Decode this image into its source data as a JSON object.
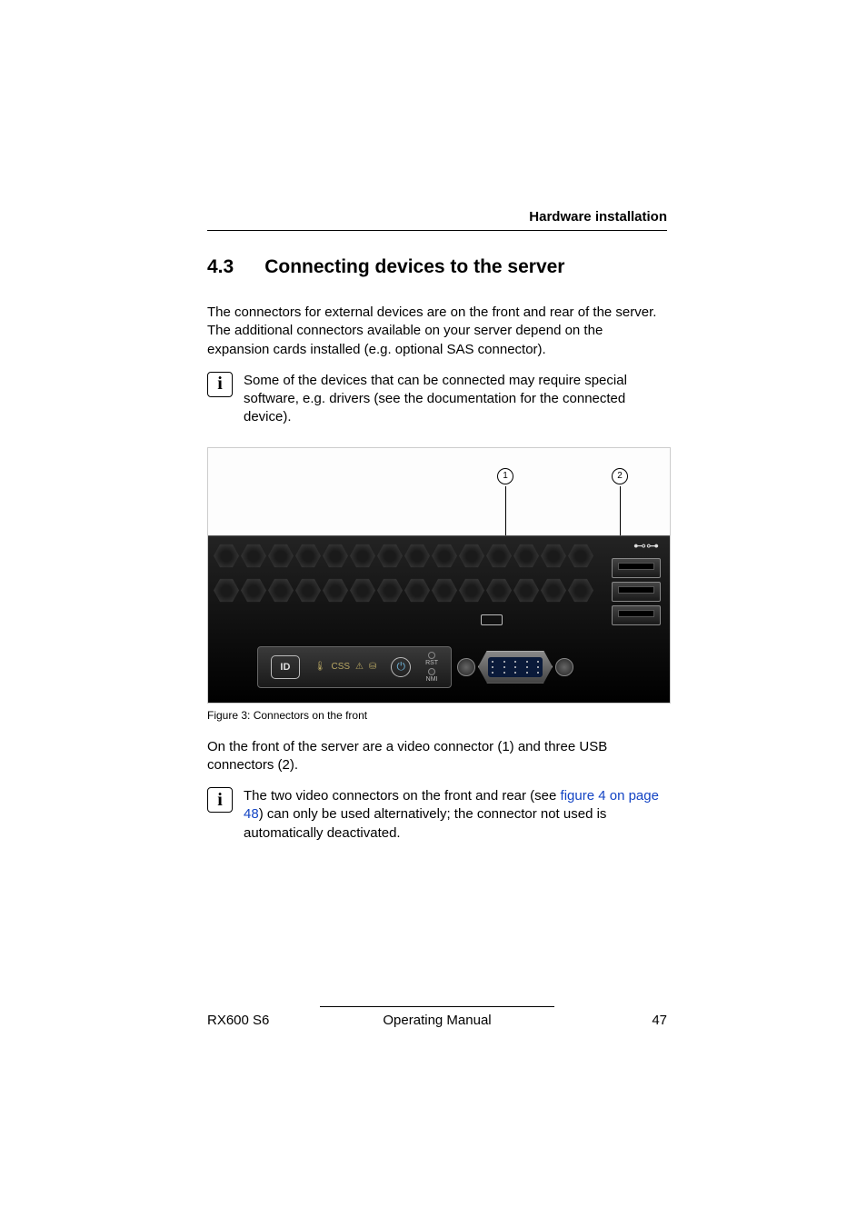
{
  "header": {
    "running_title": "Hardware installation"
  },
  "section": {
    "number": "4.3",
    "title": "Connecting devices to the server"
  },
  "paragraphs": {
    "intro": "The connectors for external devices are on the front and rear of the server. The additional connectors available on your server depend on the expansion cards installed (e.g. optional SAS connector).",
    "front_desc": "On the front of the server are a video connector (1) and three USB connectors (2)."
  },
  "notes": {
    "note1": "Some of the devices that can be connected may require special software, e.g. drivers (see the documentation for the connected device).",
    "note2_before_link": "The two video connectors on the front and rear (see ",
    "note2_link": "figure 4 on page 48",
    "note2_after_link": ") can only be used alternatively; the connector not used is automatically deactivated."
  },
  "figure": {
    "callout1": "1",
    "callout2": "2",
    "id_label": "ID",
    "rst_label": "RST",
    "nmi_label": "NMI",
    "caption": "Figure 3: Connectors on the front"
  },
  "icons": {
    "info": "i",
    "power": "⏻",
    "usb": "⊷⊶",
    "warn": "⚠",
    "css": "CSS",
    "temp": "🌡",
    "disk": "⛁"
  },
  "footer": {
    "left": "RX600 S6",
    "center": "Operating Manual",
    "right": "47"
  }
}
